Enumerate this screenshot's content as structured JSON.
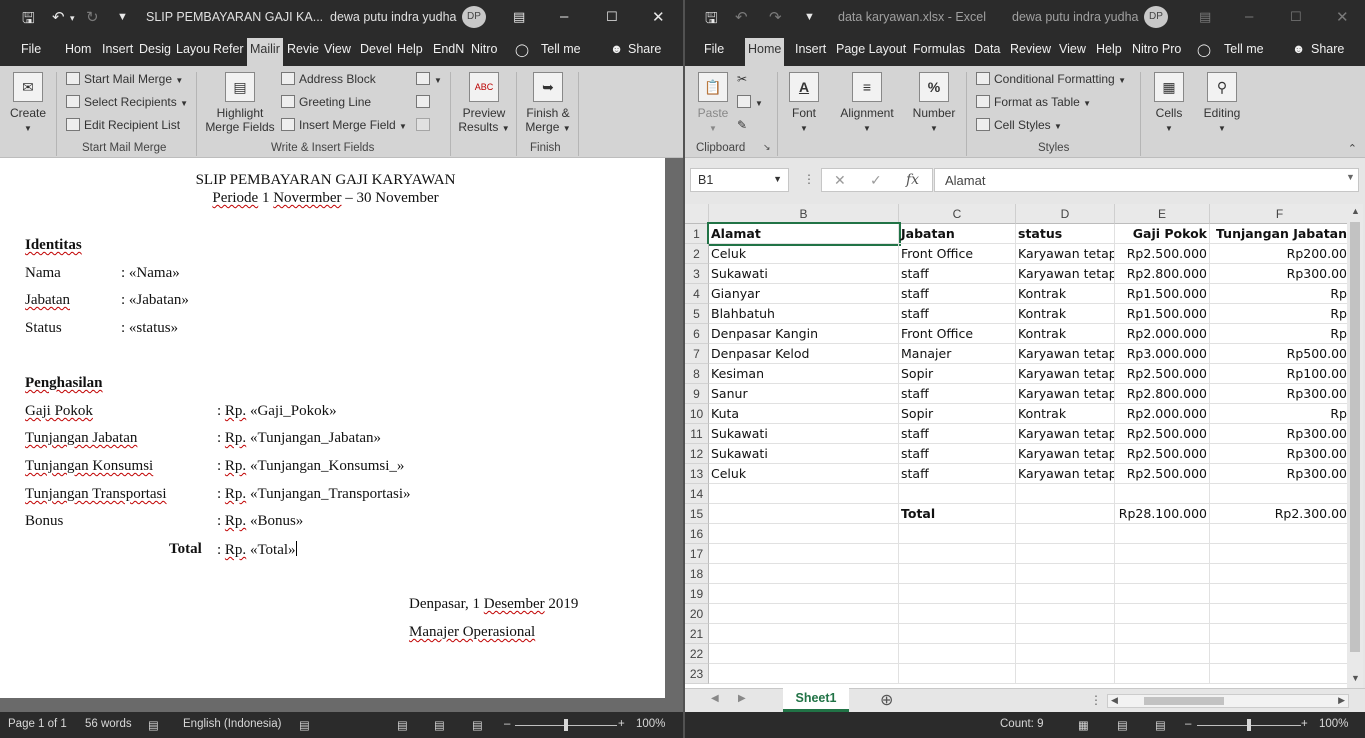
{
  "word": {
    "title": "SLIP PEMBAYARAN GAJI KA...",
    "user": "dewa putu indra yudha",
    "avatar": "DP",
    "tabs": [
      "File",
      "Hom",
      "Insert",
      "Desig",
      "Layou",
      "Refer",
      "Mailir",
      "Revie",
      "View",
      "Devel",
      "Help",
      "EndN",
      "Nitro"
    ],
    "active_tab": "Mailir",
    "tell_me": "Tell me",
    "share": "Share",
    "ribbon": {
      "create": "Create",
      "start_mail_merge": "Start Mail Merge",
      "select_recipients": "Select Recipients",
      "edit_recipient_list": "Edit Recipient List",
      "group_start": "Start Mail Merge",
      "highlight": "Highlight",
      "merge_fields": "Merge Fields",
      "address_block": "Address Block",
      "greeting_line": "Greeting Line",
      "insert_merge_field": "Insert Merge Field",
      "group_write": "Write & Insert Fields",
      "preview": "Preview",
      "results": "Results",
      "preview_icon": "ABC",
      "finish_merge": "Finish &",
      "merge": "Merge",
      "group_finish": "Finish"
    },
    "doc": {
      "heading": "SLIP PEMBAYARAN GAJI KARYAWAN",
      "period": {
        "p1": "Periode",
        "p2": " 1 ",
        "p3": "Novermber",
        "p4": " – 30 November"
      },
      "identitas": "Identitas",
      "id_rows": [
        {
          "label": "Nama",
          "value": ": «Nama»"
        },
        {
          "label": "Jabatan",
          "value": ": «Jabatan»"
        },
        {
          "label": "Status",
          "value": ": «status»"
        }
      ],
      "penghasilan": "Penghasilan",
      "pay_rows": [
        {
          "label": "Gaji Pokok",
          "rp": "Rp.",
          "value": " «Gaji_Pokok»"
        },
        {
          "label": "Tunjangan Jabatan",
          "rp": "Rp.",
          "value": " «Tunjangan_Jabatan»"
        },
        {
          "label": "Tunjangan Konsumsi",
          "rp": "Rp.",
          "value": " «Tunjangan_Konsumsi_»"
        },
        {
          "label": "Tunjangan Transportasi",
          "rp": "Rp.",
          "value": " «Tunjangan_Transportasi»"
        },
        {
          "label": "Bonus",
          "rp": "Rp.",
          "value": " «Bonus»"
        }
      ],
      "total_label": "Total",
      "total_rp": "Rp.",
      "total_value": " «Total»",
      "place_date": {
        "a": "Denpasar, 1 ",
        "b": "Desember",
        "c": " 2019"
      },
      "signer": "Manajer Operasional"
    },
    "status": {
      "page": "Page 1 of 1",
      "words": "56 words",
      "lang": "English (Indonesia)",
      "zoom": "100%",
      "zoom_level": 0.5
    }
  },
  "excel": {
    "title": "data karyawan.xlsx  -  Excel",
    "user": "dewa putu indra yudha",
    "avatar": "DP",
    "tabs": [
      "File",
      "Home",
      "Insert",
      "Page Layout",
      "Formulas",
      "Data",
      "Review",
      "View",
      "Help",
      "Nitro Pro"
    ],
    "active_tab": "Home",
    "tell_me": "Tell me",
    "share": "Share",
    "ribbon": {
      "paste": "Paste",
      "clipboard": "Clipboard",
      "font": "Font",
      "alignment": "Alignment",
      "number": "Number",
      "cond_format": "Conditional Formatting",
      "format_table": "Format as Table",
      "cell_styles": "Cell Styles",
      "styles": "Styles",
      "cells": "Cells",
      "editing": "Editing",
      "font_icon": "A",
      "number_icon": "%"
    },
    "namebox": "B1",
    "formula": "Alamat",
    "columns": [
      "B",
      "C",
      "D",
      "E",
      "F"
    ],
    "rows": [
      [
        "Alamat",
        "Jabatan",
        "status",
        "Gaji Pokok",
        "Tunjangan Jabatan"
      ],
      [
        "Celuk",
        "Front Office",
        "Karyawan tetap",
        "Rp2.500.000",
        "Rp200.00"
      ],
      [
        "Sukawati",
        "staff",
        "Karyawan tetap",
        "Rp2.800.000",
        "Rp300.00"
      ],
      [
        "Gianyar",
        "staff",
        "Kontrak",
        "Rp1.500.000",
        "Rp"
      ],
      [
        "Blahbatuh",
        "staff",
        "Kontrak",
        "Rp1.500.000",
        "Rp"
      ],
      [
        "Denpasar Kangin",
        "Front Office",
        "Kontrak",
        "Rp2.000.000",
        "Rp"
      ],
      [
        "Denpasar Kelod",
        "Manajer",
        "Karyawan tetap",
        "Rp3.000.000",
        "Rp500.00"
      ],
      [
        "Kesiman",
        "Sopir",
        "Karyawan tetap",
        "Rp2.500.000",
        "Rp100.00"
      ],
      [
        "Sanur",
        "staff",
        "Karyawan tetap",
        "Rp2.800.000",
        "Rp300.00"
      ],
      [
        "Kuta",
        "Sopir",
        "Kontrak",
        "Rp2.000.000",
        "Rp"
      ],
      [
        "Sukawati",
        "staff",
        "Karyawan tetap",
        "Rp2.500.000",
        "Rp300.00"
      ],
      [
        "Sukawati",
        "staff",
        "Karyawan tetap",
        "Rp2.500.000",
        "Rp300.00"
      ],
      [
        "Celuk",
        "staff",
        "Karyawan tetap",
        "Rp2.500.000",
        "Rp300.00"
      ],
      [
        "",
        "",
        "",
        "",
        ""
      ],
      [
        "",
        "Total",
        "",
        "Rp28.100.000",
        "Rp2.300.00"
      ],
      [
        "",
        "",
        "",
        "",
        ""
      ],
      [
        "",
        "",
        "",
        "",
        ""
      ],
      [
        "",
        "",
        "",
        "",
        ""
      ],
      [
        "",
        "",
        "",
        "",
        ""
      ],
      [
        "",
        "",
        "",
        "",
        ""
      ],
      [
        "",
        "",
        "",
        "",
        ""
      ],
      [
        "",
        "",
        "",
        "",
        ""
      ],
      [
        "",
        "",
        "",
        "",
        ""
      ],
      [
        "",
        "",
        "",
        "",
        ""
      ]
    ],
    "row_numbers": [
      "1",
      "2",
      "3",
      "4",
      "5",
      "6",
      "7",
      "8",
      "9",
      "10",
      "11",
      "12",
      "13",
      "14",
      "15",
      "16",
      "17",
      "18",
      "19",
      "20",
      "21",
      "22",
      "23"
    ],
    "sheet": "Sheet1",
    "status": {
      "count": "Count: 9",
      "zoom": "100%",
      "zoom_level": 0.5
    }
  }
}
